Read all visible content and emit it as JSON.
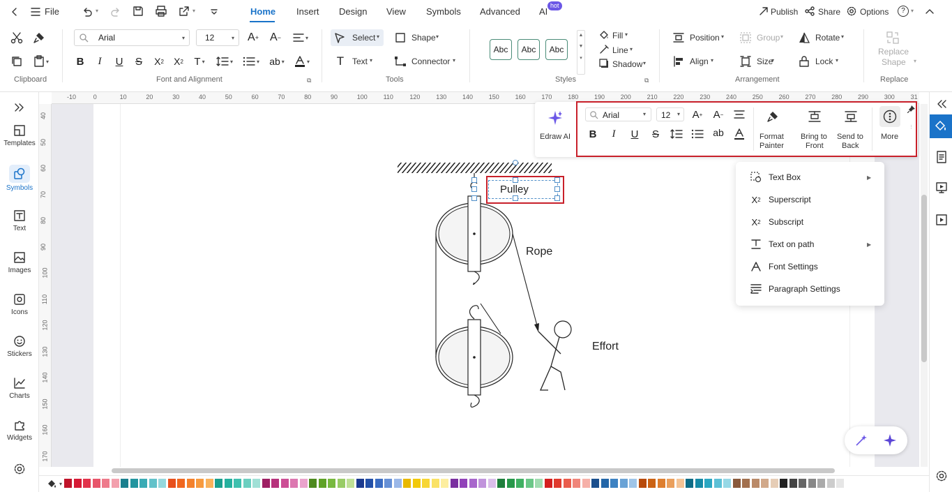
{
  "topbar": {
    "file_label": "File",
    "menu_tabs": [
      "Home",
      "Insert",
      "Design",
      "View",
      "Symbols",
      "Advanced",
      "AI"
    ],
    "ai_badge": "hot",
    "publish_label": "Publish",
    "share_label": "Share",
    "options_label": "Options",
    "help_label": "?"
  },
  "ribbon": {
    "font_name": "Arial",
    "font_size": "12",
    "select_label": "Select",
    "shape_label": "Shape",
    "text_label": "Text",
    "connector_label": "Connector",
    "style_samples": [
      "Abc",
      "Abc",
      "Abc"
    ],
    "fill_label": "Fill",
    "line_label": "Line",
    "shadow_label": "Shadow",
    "position_label": "Position",
    "group_label": "Group",
    "rotate_label": "Rotate",
    "align_label": "Align",
    "size_label": "Size",
    "lock_label": "Lock",
    "replace_shape_line1": "Replace",
    "replace_shape_line2": "Shape",
    "groups": {
      "clipboard": "Clipboard",
      "font_alignment": "Font and Alignment",
      "tools": "Tools",
      "styles": "Styles",
      "arrangement": "Arrangement",
      "replace": "Replace"
    }
  },
  "leftnav": [
    "Templates",
    "Symbols",
    "Text",
    "Images",
    "Icons",
    "Stickers",
    "Charts",
    "Widgets"
  ],
  "ruler_top": [
    "-10",
    "0",
    "10",
    "20",
    "30",
    "40",
    "50",
    "60",
    "70",
    "80",
    "90",
    "100",
    "110",
    "120",
    "130",
    "140",
    "150",
    "160",
    "170",
    "180",
    "190",
    "200",
    "210",
    "220",
    "230",
    "240",
    "250",
    "260",
    "270",
    "280",
    "290",
    "300",
    "31"
  ],
  "ruler_left": [
    "40",
    "50",
    "60",
    "70",
    "80",
    "90",
    "100",
    "110",
    "120",
    "130",
    "140",
    "150",
    "160",
    "170"
  ],
  "diagram": {
    "pulley_label": "Pulley",
    "rope_label": "Rope",
    "effort_label": "Effort"
  },
  "floatbar": {
    "edraw_ai_label": "Edraw AI",
    "font_name": "Arial",
    "font_size": "12",
    "format_painter_line1": "Format",
    "format_painter_line2": "Painter",
    "bring_front_line1": "Bring to",
    "bring_front_line2": "Front",
    "send_back_line1": "Send to",
    "send_back_line2": "Back",
    "more_label": "More"
  },
  "context_menu": [
    {
      "label": "Text Box",
      "submenu": true
    },
    {
      "label": "Superscript",
      "submenu": false
    },
    {
      "label": "Subscript",
      "submenu": false
    },
    {
      "label": "Text on path",
      "submenu": true
    },
    {
      "label": "Font Settings",
      "submenu": false
    },
    {
      "label": "Paragraph Settings",
      "submenu": false
    }
  ],
  "colors": {
    "accent": "#1a73c9",
    "highlight_red": "#c8202a",
    "palette": [
      "#c0142a",
      "#d61a35",
      "#e2334b",
      "#e8556a",
      "#ee7a8b",
      "#f3a0ad",
      "#1a7f8e",
      "#22959f",
      "#3aabb5",
      "#62c2ca",
      "#96d8dd",
      "#e8501c",
      "#f0671f",
      "#f4812c",
      "#f79a3e",
      "#f9b25c",
      "#1a9f8e",
      "#24b09e",
      "#3ec0ae",
      "#6bcfc0",
      "#a0e0d6",
      "#9e1f63",
      "#b7327c",
      "#cc4e95",
      "#dc77b0",
      "#eaa3cc",
      "#4d8a1e",
      "#5fa226",
      "#78b93f",
      "#98cc65",
      "#bfe096",
      "#1b3a8f",
      "#2350a8",
      "#3a6cc2",
      "#6690d6",
      "#9bb8e8",
      "#e8b800",
      "#f2c90a",
      "#f7d634",
      "#fae266",
      "#fdee9f",
      "#7a2fa0",
      "#9142b9",
      "#a866cc",
      "#c193dc",
      "#dbbfeb",
      "#1e7f3c",
      "#27984a",
      "#3fb062",
      "#6ac787",
      "#a0dcb0",
      "#d42020",
      "#e03a2e",
      "#ea5c4c",
      "#f0857a",
      "#f6b0a8",
      "#1a4f8e",
      "#2366a8",
      "#3d82c2",
      "#6aa3d6",
      "#9fc5e8",
      "#b84a0a",
      "#cc6314",
      "#de7e2e",
      "#ea9f5c",
      "#f4c395",
      "#0e6c86",
      "#168aa6",
      "#2ba7c2",
      "#5cc0d6",
      "#96d8e6",
      "#8a5a3c",
      "#a2704e",
      "#ba8a68",
      "#d1a98b",
      "#e6cdb6",
      "#222222",
      "#444444",
      "#666666",
      "#888888",
      "#aaaaaa",
      "#cccccc",
      "#e6e6e6"
    ]
  }
}
